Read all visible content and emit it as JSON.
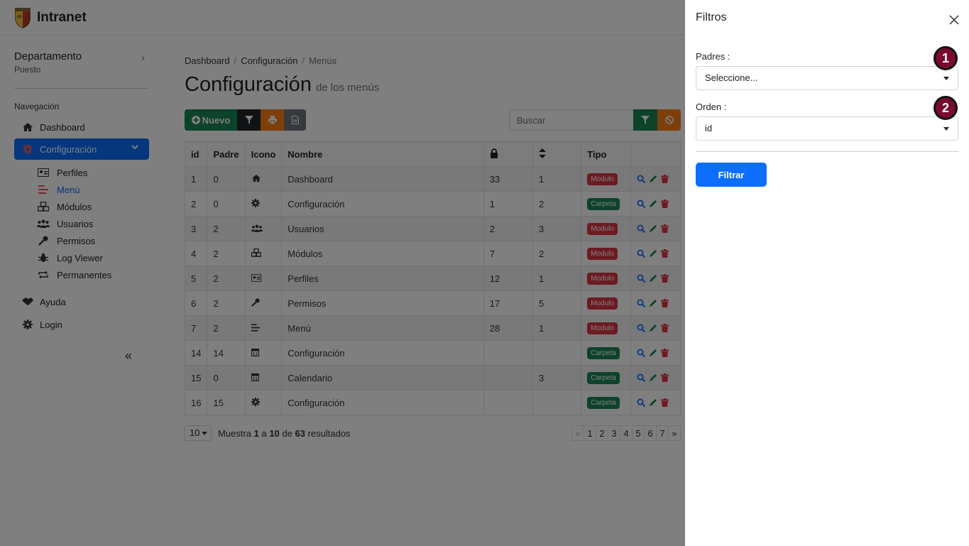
{
  "app": {
    "title": "Intranet"
  },
  "sidebar": {
    "department": "Departamento",
    "position": "Puesto",
    "nav_title": "Navegación",
    "items": [
      {
        "label": "Dashboard",
        "icon": "home-icon"
      },
      {
        "label": "Configuración",
        "icon": "gear-icon",
        "active": true
      },
      {
        "label": "Ayuda",
        "icon": "handshake-icon"
      },
      {
        "label": "Login",
        "icon": "gear-icon"
      }
    ],
    "subitems": [
      {
        "label": "Perfiles",
        "icon": "id-card-icon"
      },
      {
        "label": "Menú",
        "icon": "menu-lines-icon",
        "current": true
      },
      {
        "label": "Módulos",
        "icon": "cubes-icon"
      },
      {
        "label": "Usuarios",
        "icon": "users-icon"
      },
      {
        "label": "Permisos",
        "icon": "key-icon"
      },
      {
        "label": "Log Viewer",
        "icon": "bug-icon"
      },
      {
        "label": "Permanentes",
        "icon": "repeat-icon"
      }
    ],
    "collapse_label": "«"
  },
  "breadcrumb": [
    "Dashboard",
    "Configuración",
    "Menús"
  ],
  "page": {
    "title": "Configuración",
    "subtitle": "de los menús"
  },
  "toolbar": {
    "new_label": "Nuevo"
  },
  "search": {
    "placeholder": "Buscar"
  },
  "table": {
    "headers": [
      "id",
      "Padre",
      "Icono",
      "Nombre",
      "",
      "",
      "Tipo",
      ""
    ],
    "rows": [
      {
        "id": "1",
        "padre": "0",
        "icon": "home-icon",
        "nombre": "Dashboard",
        "c1": "33",
        "c2": "1",
        "tipo": "Modulo"
      },
      {
        "id": "2",
        "padre": "0",
        "icon": "gear-icon",
        "nombre": "Configuración",
        "c1": "1",
        "c2": "2",
        "tipo": "Carpeta"
      },
      {
        "id": "3",
        "padre": "2",
        "icon": "users-icon",
        "nombre": "Usuarios",
        "c1": "2",
        "c2": "3",
        "tipo": "Modulo"
      },
      {
        "id": "4",
        "padre": "2",
        "icon": "cubes-icon",
        "nombre": "Módulos",
        "c1": "7",
        "c2": "2",
        "tipo": "Modulo"
      },
      {
        "id": "5",
        "padre": "2",
        "icon": "id-card-icon",
        "nombre": "Perfiles",
        "c1": "12",
        "c2": "1",
        "tipo": "Modulo"
      },
      {
        "id": "6",
        "padre": "2",
        "icon": "key-icon",
        "nombre": "Permisos",
        "c1": "17",
        "c2": "5",
        "tipo": "Modulo"
      },
      {
        "id": "7",
        "padre": "2",
        "icon": "menu-lines-icon",
        "nombre": "Menú",
        "c1": "28",
        "c2": "1",
        "tipo": "Modulo"
      },
      {
        "id": "14",
        "padre": "14",
        "icon": "calendar-icon",
        "nombre": "Configuración",
        "c1": "",
        "c2": "",
        "tipo": "Carpeta"
      },
      {
        "id": "15",
        "padre": "0",
        "icon": "calendar-icon",
        "nombre": "Calendario",
        "c1": "",
        "c2": "3",
        "tipo": "Carpeta"
      },
      {
        "id": "16",
        "padre": "15",
        "icon": "gear-icon",
        "nombre": "Configuración",
        "c1": "",
        "c2": "",
        "tipo": "Carpeta"
      }
    ]
  },
  "pagination": {
    "per_page": "10",
    "info_prefix": "Muestra",
    "from": "1",
    "a": "a",
    "to": "10",
    "de": "de",
    "total": "63",
    "suffix": "resultados",
    "pages": [
      "«",
      "1",
      "2",
      "3",
      "4",
      "5",
      "6",
      "7",
      "»"
    ]
  },
  "drawer": {
    "title": "Filtros",
    "fields": [
      {
        "label": "Padres :",
        "value": "Seleccione...",
        "marker": "1"
      },
      {
        "label": "Orden :",
        "value": "id",
        "marker": "2"
      }
    ],
    "submit_label": "Filtrar"
  },
  "colors": {
    "primary": "#0d6efd",
    "success": "#198754",
    "danger": "#dc3545",
    "warning": "#fd7e14",
    "marker": "#7a0a2f"
  }
}
